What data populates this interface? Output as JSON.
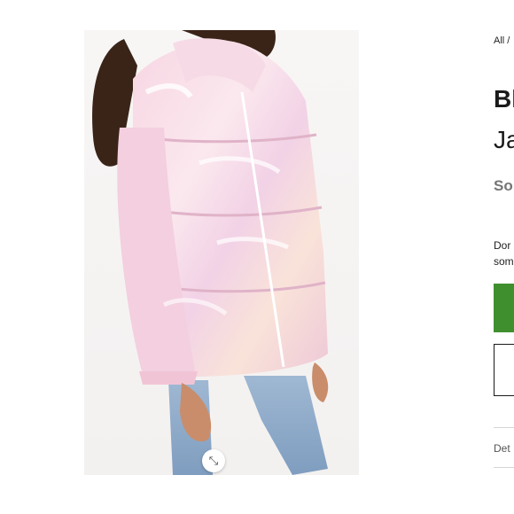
{
  "breadcrumb": {
    "text": "All /"
  },
  "product": {
    "title_line1": "Bl",
    "title_line2": "Ja",
    "brand": "So",
    "promo_line1": "Dor",
    "promo_line2": "som"
  },
  "actions": {
    "add_to_bag_color": "#3f8f2f",
    "expand_icon": "⤡"
  },
  "tabs": {
    "details_label": "Det"
  }
}
